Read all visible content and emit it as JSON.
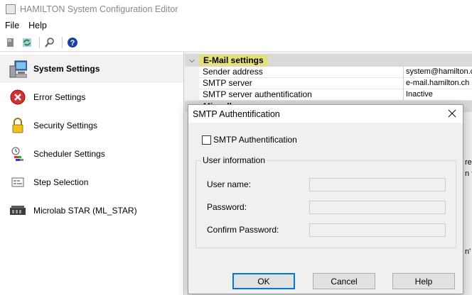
{
  "window": {
    "title": "HAMILTON System Configuration Editor"
  },
  "menu": {
    "items": [
      "File",
      "Help"
    ]
  },
  "sidebar": {
    "items": [
      {
        "label": "System Settings",
        "icon": "computer-icon"
      },
      {
        "label": "Error Settings",
        "icon": "error-icon"
      },
      {
        "label": "Security Settings",
        "icon": "lock-icon"
      },
      {
        "label": "Scheduler Settings",
        "icon": "scheduler-icon"
      },
      {
        "label": "Step Selection",
        "icon": "steps-icon"
      },
      {
        "label": "Microlab STAR (ML_STAR)",
        "icon": "instrument-icon"
      }
    ]
  },
  "properties": {
    "category": "E-Mail settings",
    "rows": [
      {
        "name": "Sender address",
        "value": "system@hamilton.ch"
      },
      {
        "name": "SMTP server",
        "value": "e-mail.hamilton.ch"
      },
      {
        "name": "SMTP server authentification",
        "value": "Inactive"
      }
    ],
    "next_category": "Miscellaneous",
    "obscured_values": [
      "re I",
      "n f",
      "n'"
    ]
  },
  "dialog": {
    "title": "SMTP Authentification",
    "checkbox_label": "SMTP Authentification",
    "checkbox_checked": false,
    "group_label": "User information",
    "fields": [
      {
        "label": "User name:",
        "value": ""
      },
      {
        "label": "Password:",
        "value": ""
      },
      {
        "label": "Confirm Password:",
        "value": ""
      }
    ],
    "buttons": {
      "ok": "OK",
      "cancel": "Cancel",
      "help": "Help"
    }
  },
  "colors": {
    "category_highlight": "#e5e07a",
    "default_button_border": "#0078d7",
    "help_icon": "#1c3fa6"
  }
}
